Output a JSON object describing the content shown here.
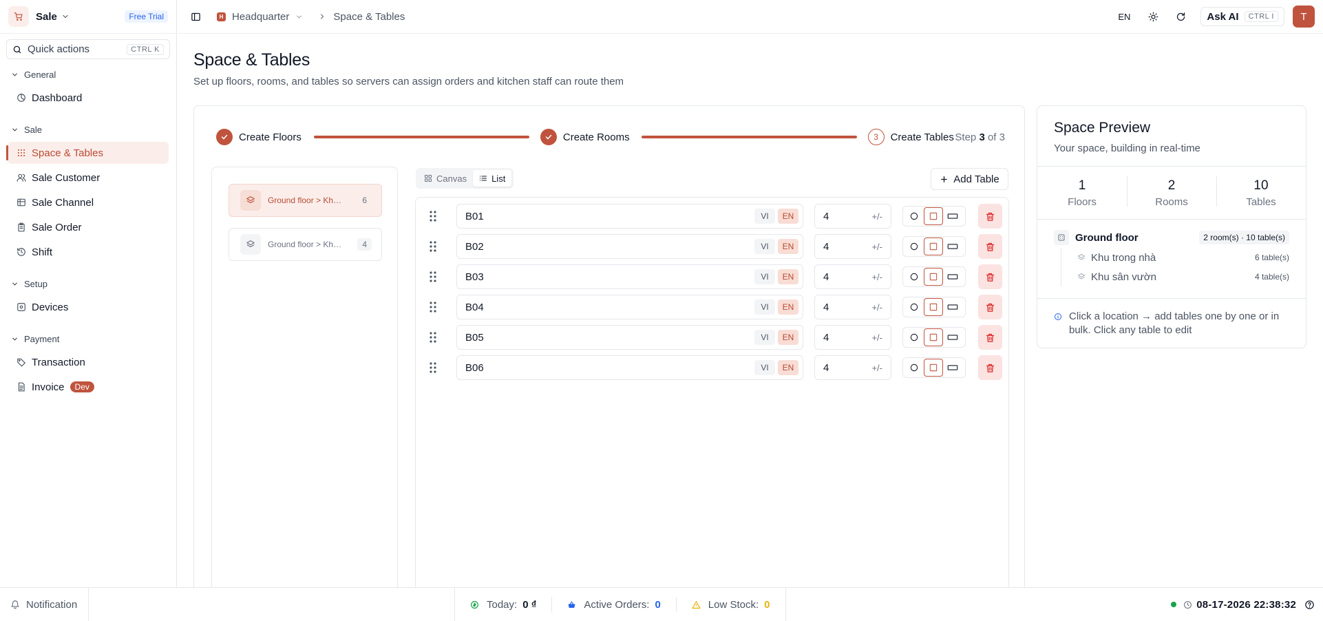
{
  "app": {
    "name": "Sale",
    "trial_label": "Free Trial"
  },
  "quick_actions": {
    "label": "Quick actions",
    "shortcut": "CTRL K"
  },
  "sidebar": {
    "groups": [
      {
        "label": "General",
        "items": [
          {
            "label": "Dashboard",
            "icon": "dashboard-icon"
          }
        ]
      },
      {
        "label": "Sale",
        "items": [
          {
            "label": "Space & Tables",
            "icon": "grid-dots-icon",
            "active": true
          },
          {
            "label": "Sale Customer",
            "icon": "users-icon"
          },
          {
            "label": "Sale Channel",
            "icon": "channel-icon"
          },
          {
            "label": "Sale Order",
            "icon": "clipboard-icon"
          },
          {
            "label": "Shift",
            "icon": "history-icon"
          }
        ]
      },
      {
        "label": "Setup",
        "items": [
          {
            "label": "Devices",
            "icon": "devices-icon"
          }
        ]
      },
      {
        "label": "Payment",
        "items": [
          {
            "label": "Transaction",
            "icon": "tag-icon"
          },
          {
            "label": "Invoice",
            "icon": "invoice-icon",
            "badge": "Dev"
          }
        ]
      }
    ]
  },
  "topbar": {
    "org_initial": "H",
    "org_name": "Headquarter",
    "page": "Space & Tables",
    "language": "EN",
    "ask_ai_label": "Ask AI",
    "ask_ai_shortcut": "CTRL I",
    "user_initial": "T"
  },
  "page": {
    "title": "Space & Tables",
    "subtitle": "Set up floors, rooms, and tables so servers can assign orders and kitchen staff can route them"
  },
  "stepper": {
    "steps": [
      {
        "label": "Create Floors",
        "status": "done"
      },
      {
        "label": "Create Rooms",
        "status": "done"
      },
      {
        "label": "Create Tables",
        "status": "current",
        "number": "3"
      }
    ],
    "count_prefix": "Step",
    "current": "3",
    "count_mid": "of",
    "total": "3"
  },
  "locations": [
    {
      "label": "Ground floor > Khu trong nhà",
      "count": "6",
      "active": true
    },
    {
      "label": "Ground floor > Khu sân vườn",
      "count": "4",
      "active": false
    }
  ],
  "view_toggle": {
    "canvas_label": "Canvas",
    "list_label": "List",
    "selected": "List"
  },
  "add_table_label": "Add Table",
  "tables": [
    {
      "name": "B01",
      "lang_vi": "VI",
      "lang_en": "EN",
      "seats": "4",
      "seats_control": "+/-",
      "shape": "square"
    },
    {
      "name": "B02",
      "lang_vi": "VI",
      "lang_en": "EN",
      "seats": "4",
      "seats_control": "+/-",
      "shape": "square"
    },
    {
      "name": "B03",
      "lang_vi": "VI",
      "lang_en": "EN",
      "seats": "4",
      "seats_control": "+/-",
      "shape": "square"
    },
    {
      "name": "B04",
      "lang_vi": "VI",
      "lang_en": "EN",
      "seats": "4",
      "seats_control": "+/-",
      "shape": "square"
    },
    {
      "name": "B05",
      "lang_vi": "VI",
      "lang_en": "EN",
      "seats": "4",
      "seats_control": "+/-",
      "shape": "square"
    },
    {
      "name": "B06",
      "lang_vi": "VI",
      "lang_en": "EN",
      "seats": "4",
      "seats_control": "+/-",
      "shape": "square"
    }
  ],
  "preview": {
    "title": "Space Preview",
    "subtitle": "Your space, building in real-time",
    "stats": [
      {
        "value": "1",
        "label": "Floors"
      },
      {
        "value": "2",
        "label": "Rooms"
      },
      {
        "value": "10",
        "label": "Tables"
      }
    ],
    "floor": {
      "name": "Ground floor",
      "summary": "2 room(s) · 10 table(s)"
    },
    "rooms": [
      {
        "name": "Khu trong nhà",
        "tables": "6 table(s)"
      },
      {
        "name": "Khu sân vườn",
        "tables": "4 table(s)"
      }
    ],
    "hint": "Click a location → add tables one by one or in bulk. Click any table to edit"
  },
  "footer": {
    "notification_label": "Notification",
    "today_label": "Today:",
    "today_value": "0 ₫",
    "active_orders_label": "Active Orders:",
    "active_orders_value": "0",
    "low_stock_label": "Low Stock:",
    "low_stock_value": "0",
    "datetime": "08-17-2026 22:38:32"
  },
  "colors": {
    "accent": "#c0533d",
    "accent_soft": "#fbeeea",
    "success": "#16a34a",
    "info": "#2563eb",
    "warning": "#eab308"
  }
}
